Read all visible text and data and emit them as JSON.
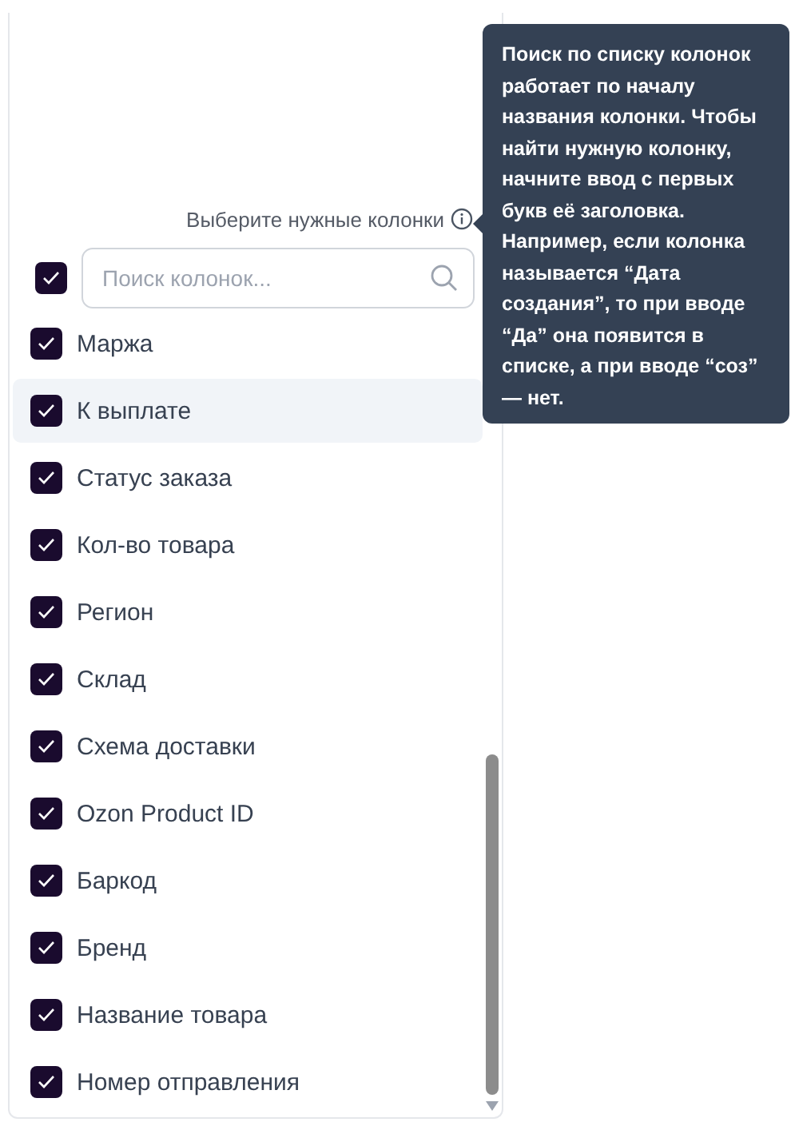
{
  "column_picker": {
    "heading": "Выберите нужные колонки",
    "select_all": {
      "checked": true
    },
    "search": {
      "placeholder": "Поиск колонок..."
    },
    "columns": [
      {
        "label": "Маржа",
        "checked": true,
        "hovered": false
      },
      {
        "label": "К выплате",
        "checked": true,
        "hovered": true
      },
      {
        "label": "Статус заказа",
        "checked": true,
        "hovered": false
      },
      {
        "label": "Кол-во товара",
        "checked": true,
        "hovered": false
      },
      {
        "label": "Регион",
        "checked": true,
        "hovered": false
      },
      {
        "label": "Склад",
        "checked": true,
        "hovered": false
      },
      {
        "label": "Схема доставки",
        "checked": true,
        "hovered": false
      },
      {
        "label": "Ozon Product ID",
        "checked": true,
        "hovered": false
      },
      {
        "label": "Баркод",
        "checked": true,
        "hovered": false
      },
      {
        "label": "Бренд",
        "checked": true,
        "hovered": false
      },
      {
        "label": "Название товара",
        "checked": true,
        "hovered": false
      },
      {
        "label": "Номер отправления",
        "checked": true,
        "hovered": false
      }
    ]
  },
  "tooltip": {
    "text": "Поиск по списку колонок работает по началу названия колонки. Чтобы найти нужную колонку, начните ввод с первых букв её заголовка. Например, если колонка называется “Дата создания”, то при вводе “Да” она появится в списке, а при вводе “соз” — нет."
  }
}
